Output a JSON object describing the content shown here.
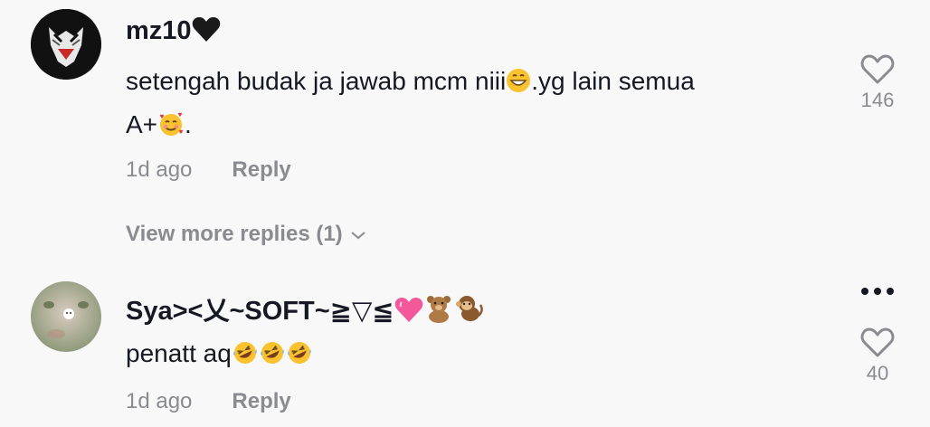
{
  "comments": [
    {
      "username_text": "mz10",
      "text_line1": "setengah budak ja jawab mcm niii",
      "text_line1_suffix": ".yg lain semua",
      "text_line2_prefix": "A+",
      "text_line2_suffix": ".",
      "time": "1d ago",
      "reply_label": "Reply",
      "like_count": "146",
      "view_more": "View more replies (1)"
    },
    {
      "username_text": "Sya><乂~SOFT~≧▽≦",
      "text": "penatt aq",
      "time": "1d ago",
      "reply_label": "Reply",
      "like_count": "40"
    }
  ],
  "icons": {
    "heart": "heart-outline-icon",
    "more": "more-horizontal-icon",
    "chevron": "chevron-down-icon"
  },
  "colors": {
    "text": "#161823",
    "secondary": "#8a8b91",
    "background": "#f8f8f8"
  }
}
